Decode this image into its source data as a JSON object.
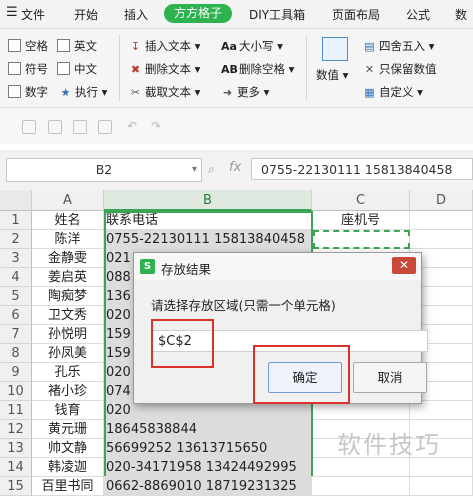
{
  "menubar": {
    "file_icon": "hamburger-icon",
    "items": [
      "文件",
      "开始",
      "插入",
      "方方格子",
      "DIY工具箱",
      "页面布局",
      "公式",
      "数"
    ]
  },
  "ribbon": {
    "checkboxes": [
      "空格",
      "英文",
      "符号",
      "中文",
      "数字"
    ],
    "execute_label": "执行",
    "insert_text": "插入文本",
    "delete_text": "删除文本",
    "extract_text": "截取文本",
    "case_label": "大小写",
    "delete_space": "删除空格",
    "more_label": "更多",
    "numeric_label": "数值",
    "round_label": "四舍五入",
    "keep_numeric": "只保留数值",
    "custom_label": "自定义"
  },
  "formula_bar": {
    "cell_ref": "B2",
    "fx": "fx",
    "content": "0755-22130111 15813840458"
  },
  "grid": {
    "columns": [
      "A",
      "B",
      "C",
      "D"
    ],
    "row_numbers": [
      "1",
      "2",
      "3",
      "4",
      "5",
      "6",
      "7",
      "8",
      "9",
      "10",
      "11",
      "12",
      "13",
      "14",
      "15"
    ],
    "rows": [
      {
        "a": "姓名",
        "b": "联系电话",
        "c": "座机号"
      },
      {
        "a": "陈洋",
        "b": "0755-22130111 15813840458",
        "c": ""
      },
      {
        "a": "金静雯",
        "b": "021",
        "c": ""
      },
      {
        "a": "姜启英",
        "b": "088",
        "c": ""
      },
      {
        "a": "陶痴梦",
        "b": "136",
        "c": ""
      },
      {
        "a": "卫文秀",
        "b": "020",
        "c": ""
      },
      {
        "a": "孙悦明",
        "b": "159",
        "c": ""
      },
      {
        "a": "孙凤美",
        "b": "159",
        "c": ""
      },
      {
        "a": "孔乐",
        "b": "020",
        "c": ""
      },
      {
        "a": "褚小珍",
        "b": "074",
        "c": ""
      },
      {
        "a": "钱育",
        "b": "020",
        "c": ""
      },
      {
        "a": "黄元珊",
        "b": "18645838844",
        "c": ""
      },
      {
        "a": "帅文静",
        "b": "56699252 13613715650",
        "c": ""
      },
      {
        "a": "韩凌迦",
        "b": "020-34171958 13424492995",
        "c": ""
      },
      {
        "a": "百里书同",
        "b": "0662-8869010 18719231325",
        "c": ""
      }
    ]
  },
  "dialog": {
    "logo": "S",
    "title": "存放结果",
    "close": "✕",
    "prompt": "请选择存放区域(只需一个单元格)",
    "input_value": "$C$2",
    "ok_label": "确定",
    "cancel_label": "取消"
  },
  "watermark": "软件技巧",
  "colors": {
    "accent_green": "#2db24f",
    "highlight_red": "#d9332b",
    "selection_green": "#3aa655"
  }
}
